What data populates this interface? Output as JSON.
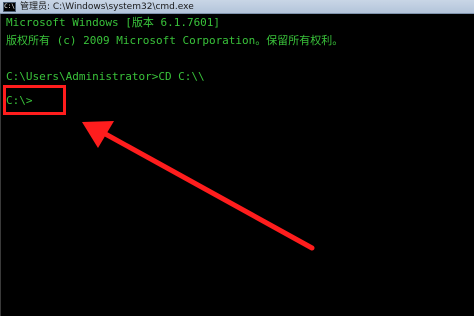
{
  "window": {
    "title": "管理员: C:\\Windows\\system32\\cmd.exe",
    "icon": "cmd-icon",
    "icon_glyph": "C:\\"
  },
  "console": {
    "lines": [
      "Microsoft Windows [版本 6.1.7601]",
      "版权所有 (c) 2009 Microsoft Corporation。保留所有权利。",
      "",
      "C:\\Users\\Administrator>CD C:\\\\",
      "",
      "C:\\>"
    ],
    "text_color": "#39c23a",
    "background": "#000000"
  },
  "annotation": {
    "highlight_color": "#ff1d1d",
    "arrow_color": "#ff1d1d"
  }
}
